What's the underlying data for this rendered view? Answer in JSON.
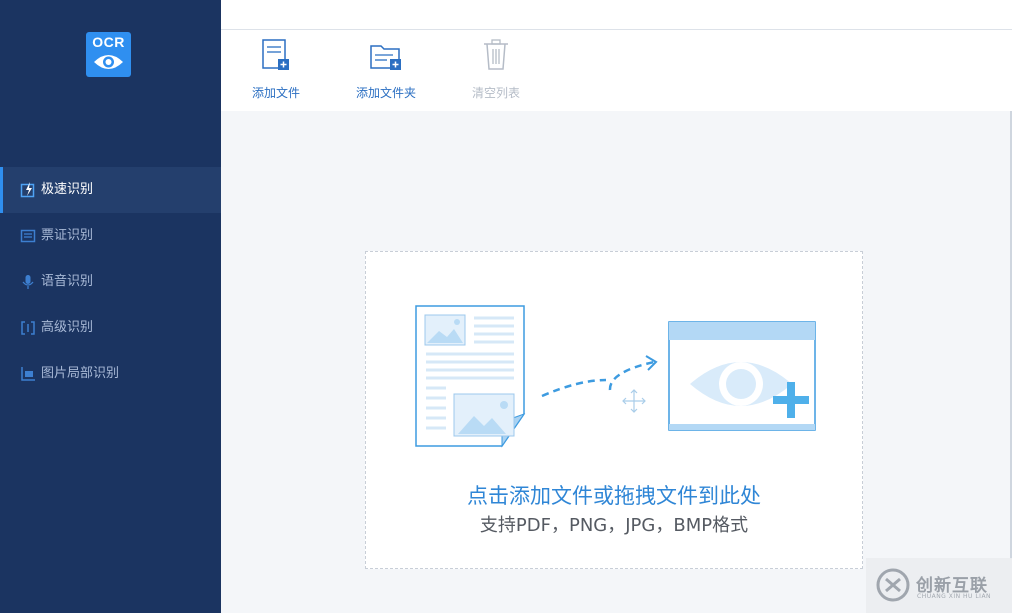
{
  "app": {
    "logo_text": "OCR"
  },
  "sidebar": {
    "items": [
      {
        "label": "极速识别",
        "icon": "lightning-doc-icon",
        "active": true
      },
      {
        "label": "票证识别",
        "icon": "ticket-icon",
        "active": false
      },
      {
        "label": "语音识别",
        "icon": "microphone-icon",
        "active": false
      },
      {
        "label": "高级识别",
        "icon": "scan-brackets-icon",
        "active": false
      },
      {
        "label": "图片局部识别",
        "icon": "partial-image-icon",
        "active": false
      }
    ]
  },
  "toolbar": {
    "add_file": "添加文件",
    "add_folder": "添加文件夹",
    "clear_list": "清空列表"
  },
  "dropzone": {
    "title": "点击添加文件或拖拽文件到此处",
    "subtitle": "支持PDF，PNG，JPG，BMP格式"
  },
  "watermark": {
    "title": "创新互联",
    "subtitle": "CHUANG XIN HU LIAN"
  },
  "colors": {
    "sidebar_bg": "#1b3461",
    "accent": "#2f8ff0",
    "link_blue": "#2b6fc2"
  }
}
